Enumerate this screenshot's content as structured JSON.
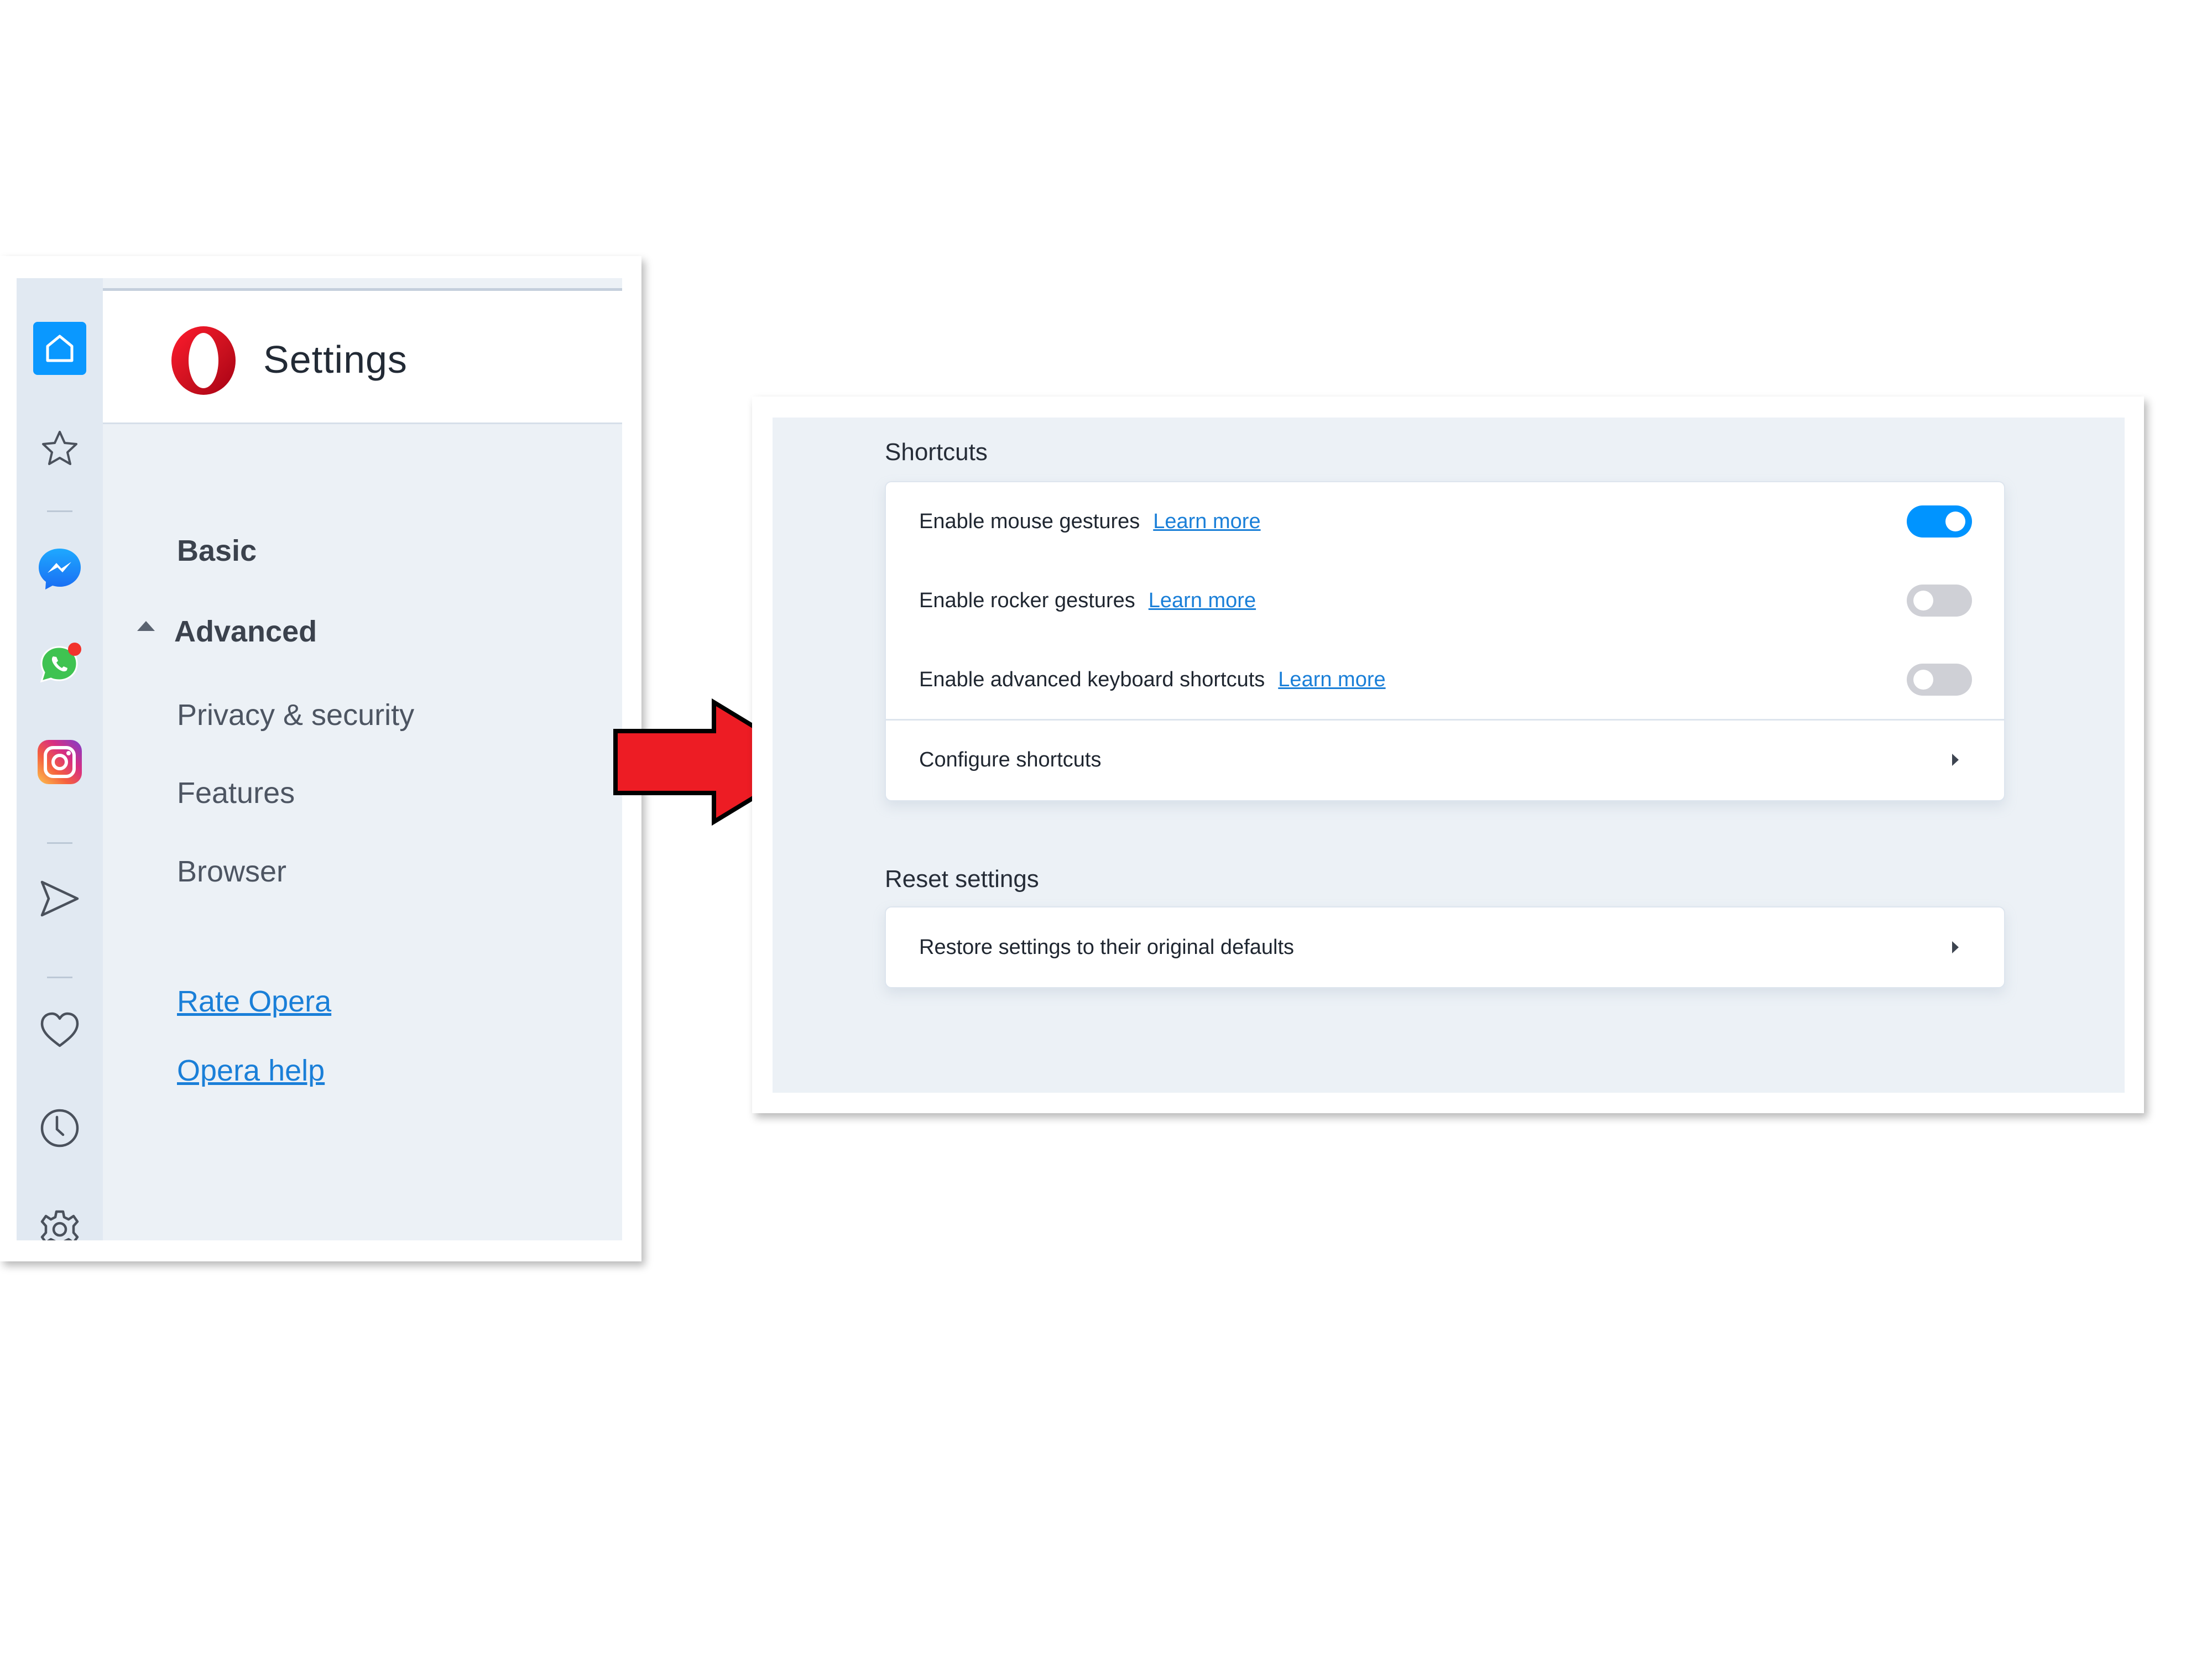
{
  "left_panel": {
    "app_title": "Settings",
    "rail_icons": [
      {
        "name": "home-icon",
        "active": true
      },
      {
        "name": "star-icon"
      },
      {
        "name": "messenger-icon"
      },
      {
        "name": "whatsapp-icon",
        "notification": true
      },
      {
        "name": "instagram-icon"
      },
      {
        "name": "send-icon"
      },
      {
        "name": "heart-icon"
      },
      {
        "name": "history-clock-icon"
      },
      {
        "name": "gear-icon"
      }
    ],
    "nav": {
      "basic": "Basic",
      "advanced": "Advanced",
      "advanced_expanded": true,
      "sub_items": [
        "Privacy & security",
        "Features",
        "Browser"
      ],
      "links": [
        "Rate Opera",
        "Opera help"
      ]
    }
  },
  "annotation": {
    "arrow_direction": "right",
    "arrow_color": "#ed1c24"
  },
  "right_panel": {
    "shortcuts": {
      "title": "Shortcuts",
      "rows": [
        {
          "label": "Enable mouse gestures",
          "link": "Learn more",
          "enabled": true
        },
        {
          "label": "Enable rocker gestures",
          "link": "Learn more",
          "enabled": false
        },
        {
          "label": "Enable advanced keyboard shortcuts",
          "link": "Learn more",
          "enabled": false
        }
      ],
      "configure_label": "Configure shortcuts"
    },
    "reset": {
      "title": "Reset settings",
      "restore_label": "Restore settings to their original defaults"
    }
  },
  "colors": {
    "accent": "#0094ff",
    "link": "#1a7fd8",
    "toggle_off": "#cfd0d6",
    "page_bg": "#ecf1f6",
    "rail_bg": "#e1e9f2",
    "opera_red": "#e0101d"
  }
}
